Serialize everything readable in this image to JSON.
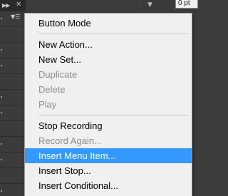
{
  "panel": {
    "collapse_icon": "double-arrow-icon",
    "close_icon": "close-icon",
    "flyout_icon": "panel-menu-icon",
    "top_field_value": "0 pt"
  },
  "menu": {
    "sections": [
      [
        {
          "label": "Button Mode",
          "enabled": true
        }
      ],
      [
        {
          "label": "New Action...",
          "enabled": true
        },
        {
          "label": "New Set...",
          "enabled": true
        },
        {
          "label": "Duplicate",
          "enabled": false
        },
        {
          "label": "Delete",
          "enabled": false
        },
        {
          "label": "Play",
          "enabled": false
        }
      ],
      [
        {
          "label": "Stop Recording",
          "enabled": true
        },
        {
          "label": "Record Again...",
          "enabled": false
        },
        {
          "label": "Insert Menu Item...",
          "enabled": true,
          "highlighted": true
        },
        {
          "label": "Insert Stop...",
          "enabled": true
        },
        {
          "label": "Insert Conditional...",
          "enabled": true
        }
      ]
    ]
  },
  "colors": {
    "highlight": "#3399ff",
    "menu_background": "#f0f0f0",
    "disabled_text": "#8d8d8d",
    "panel_background": "#3c3c3c"
  }
}
